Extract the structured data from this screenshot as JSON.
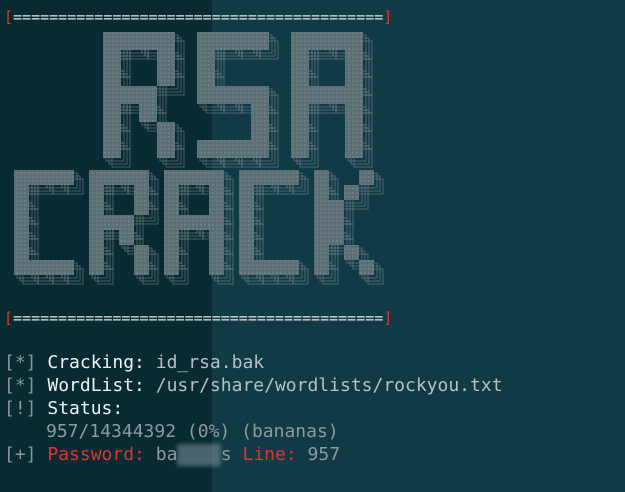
{
  "colors": {
    "background_left": "#072a33",
    "background_right": "#0f3a46",
    "bracket_red": "#e0352b",
    "ascii_fill": "#5b6f75",
    "ascii_outline": "#7d8b90",
    "label_white": "#eef2f3",
    "dim_gray": "#8f999e",
    "error_red": "#e0352b"
  },
  "banner": {
    "open_bracket": "[",
    "rule": "=========================================",
    "close_bracket": "]"
  },
  "logo": {
    "line1": "RSA",
    "line2": "CRACK"
  },
  "output": {
    "cracking": {
      "tag": "[*]",
      "label": "Cracking:",
      "value": "id_rsa.bak"
    },
    "wordlist": {
      "tag": "[*]",
      "label": "WordList:",
      "value": "/usr/share/wordlists/rockyou.txt"
    },
    "status": {
      "tag": "[!]",
      "label": "Status:"
    },
    "progress": {
      "current": "957",
      "total": "14344392",
      "percent": "(0%)",
      "word": "(bananas)"
    },
    "password": {
      "tag": "[+]",
      "label": "Password:",
      "value_visible_start": "ba",
      "value_visible_end": "s",
      "line_label": "Line:",
      "line_value": "957"
    }
  }
}
